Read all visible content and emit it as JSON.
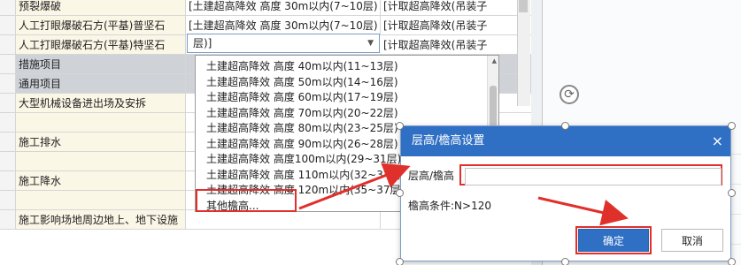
{
  "grid": {
    "rows": [
      {
        "num": "",
        "name": "预裂爆破",
        "col2": "[土建超高降效 高度 30m以内(7~10层)",
        "col3": "[计取超高降效(吊装子"
      },
      {
        "num": "",
        "name": "人工打眼爆破石方(平基)普坚石",
        "col2": "[土建超高降效 高度 30m以内(7~10层)",
        "col3": "[计取超高降效(吊装子"
      },
      {
        "num": "",
        "name": "人工打眼爆破石方(平基)特坚石",
        "col2": "层)]",
        "col3": "[计取超高降效(吊装子"
      },
      {
        "num": "",
        "name": "措施项目",
        "col2": "",
        "col3": ""
      },
      {
        "num": "",
        "name": "通用项目",
        "col2": "",
        "col3": ""
      },
      {
        "num": "",
        "name": "大型机械设备进出场及安拆",
        "col2": "",
        "col3": ""
      },
      {
        "num": "",
        "name": "",
        "col2": "",
        "col3": ""
      },
      {
        "num": "",
        "name": "施工排水",
        "col2": "",
        "col3": ""
      },
      {
        "num": "",
        "name": "",
        "col2": "",
        "col3": ""
      },
      {
        "num": "",
        "name": "施工降水",
        "col2": "",
        "col3": ""
      },
      {
        "num": "",
        "name": "",
        "col2": "",
        "col3": ""
      },
      {
        "num": "",
        "name": "施工影响场地周边地上、地下设施",
        "col2": "",
        "col3": ""
      }
    ],
    "combo_value": "层)]"
  },
  "dropdown": {
    "items": [
      "土建超高降效 高度 40m以内(11~13层)",
      "土建超高降效 高度 50m以内(14~16层)",
      "土建超高降效 高度 60m以内(17~19层)",
      "土建超高降效 高度 70m以内(20~22层)",
      "土建超高降效 高度 80m以内(23~25层)",
      "土建超高降效 高度 90m以内(26~28层)",
      "土建超高降效 高度100m以内(29~31层)",
      "土建超高降效 高度 110m以内(32~34层)",
      "土建超高降效 高度 120m以内(35~37层)",
      "其他檐高..."
    ]
  },
  "dialog": {
    "title": "层高/檐高设置",
    "close": "×",
    "label": "层高/檐高",
    "input_value": "",
    "condition": "檐高条件:N>120",
    "ok": "确定",
    "cancel": "取消"
  },
  "colors": {
    "accent": "#2f6fc4",
    "highlight": "#e0302c"
  }
}
